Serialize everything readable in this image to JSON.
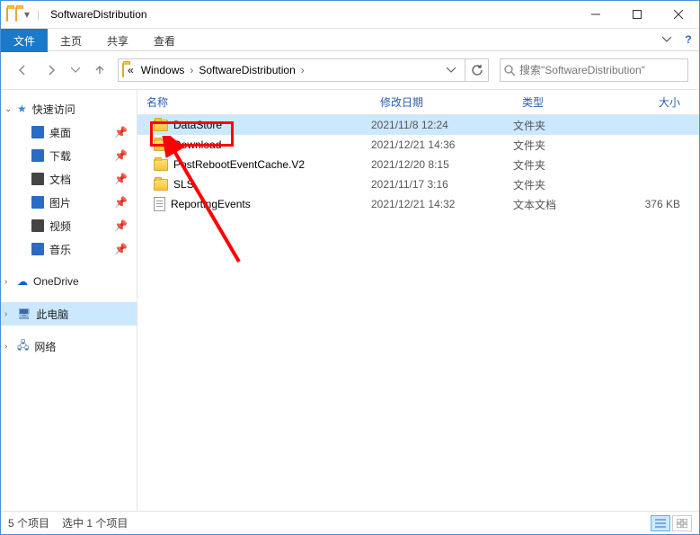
{
  "window": {
    "title": "SoftwareDistribution"
  },
  "tabs": {
    "file": "文件",
    "home": "主页",
    "share": "共享",
    "view": "查看"
  },
  "breadcrumb": {
    "parts": [
      "«",
      "Windows",
      "SoftwareDistribution"
    ]
  },
  "search": {
    "placeholder": "搜索\"SoftwareDistribution\""
  },
  "sidebar": {
    "quickaccess": "快速访问",
    "items": [
      {
        "label": "桌面",
        "color": "#2a6bc4",
        "pinned": true
      },
      {
        "label": "下载",
        "color": "#2a6bc4",
        "pinned": true
      },
      {
        "label": "文档",
        "color": "#444",
        "pinned": true
      },
      {
        "label": "图片",
        "color": "#2a6bc4",
        "pinned": true
      },
      {
        "label": "视频",
        "color": "#444",
        "pinned": true
      },
      {
        "label": "音乐",
        "color": "#2a6bc4",
        "pinned": true
      }
    ],
    "onedrive": "OneDrive",
    "thispc": "此电脑",
    "network": "网络"
  },
  "headers": {
    "name": "名称",
    "date": "修改日期",
    "type": "类型",
    "size": "大小"
  },
  "files": [
    {
      "name": "DataStore",
      "date": "2021/11/8 12:24",
      "type": "文件夹",
      "size": "",
      "kind": "folder",
      "selected": true
    },
    {
      "name": "Download",
      "date": "2021/12/21 14:36",
      "type": "文件夹",
      "size": "",
      "kind": "folder"
    },
    {
      "name": "PostRebootEventCache.V2",
      "date": "2021/12/20 8:15",
      "type": "文件夹",
      "size": "",
      "kind": "folder"
    },
    {
      "name": "SLS",
      "date": "2021/11/17 3:16",
      "type": "文件夹",
      "size": "",
      "kind": "folder"
    },
    {
      "name": "ReportingEvents",
      "date": "2021/12/21 14:32",
      "type": "文本文档",
      "size": "376 KB",
      "kind": "file"
    }
  ],
  "status": {
    "count": "5 个项目",
    "sel": "选中 1 个项目"
  }
}
